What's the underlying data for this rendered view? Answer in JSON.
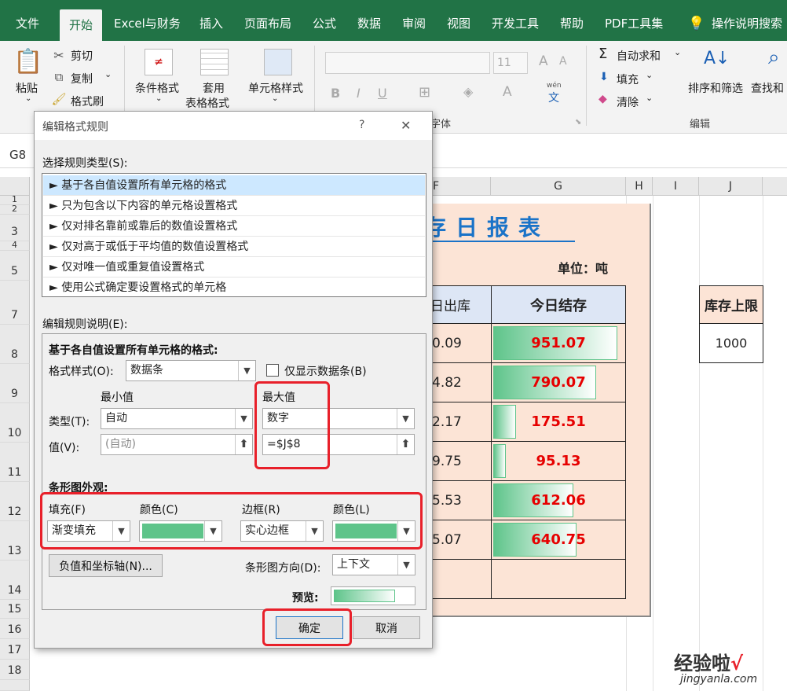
{
  "tabs": [
    "文件",
    "开始",
    "Excel与财务",
    "插入",
    "页面布局",
    "公式",
    "数据",
    "审阅",
    "视图",
    "开发工具",
    "帮助",
    "PDF工具集",
    "操作说明搜索"
  ],
  "ribbon": {
    "paste": "粘贴",
    "cut": "剪切",
    "copy": "复制",
    "format_painter": "格式刷",
    "cond_format": "条件格式",
    "table_format_1": "套用",
    "table_format_2": "表格格式",
    "cell_style": "单元格样式",
    "font_size": "11",
    "font_group": "字体",
    "bold": "B",
    "italic": "I",
    "underline": "U",
    "wen": "wén",
    "autosum": "自动求和",
    "fill": "填充",
    "clear": "清除",
    "edit_group": "编辑",
    "sort_filter": "排序和筛选",
    "find": "查找和"
  },
  "name_box": "G8",
  "columns": [
    "F",
    "G",
    "H",
    "I",
    "J"
  ],
  "rows": [
    "1",
    "2",
    "3",
    "4",
    "5",
    "7",
    "8",
    "9",
    "10",
    "11",
    "12",
    "13",
    "14",
    "15",
    "16",
    "17",
    "18"
  ],
  "report": {
    "title": "库存日报表",
    "unit": "单位：吨",
    "col_out": "日出库",
    "col_stock": "今日结存",
    "out_values": [
      "0.09",
      "4.82",
      "2.17",
      "9.75",
      "5.53",
      "5.07"
    ],
    "stock_values": [
      951.07,
      790.07,
      175.51,
      95.13,
      612.06,
      640.75
    ],
    "stock_labels": [
      "951.07",
      "790.07",
      "175.51",
      "95.13",
      "612.06",
      "640.75"
    ],
    "max_stock": 1000
  },
  "limit": {
    "header": "库存上限",
    "value": "1000"
  },
  "dialog": {
    "title": "编辑格式规则",
    "help": "?",
    "close": "✕",
    "rule_type_label": "选择规则类型(S):",
    "rules": [
      "► 基于各自值设置所有单元格的格式",
      "► 只为包含以下内容的单元格设置格式",
      "► 仅对排名靠前或靠后的数值设置格式",
      "► 仅对高于或低于平均值的数值设置格式",
      "► 仅对唯一值或重复值设置格式",
      "► 使用公式确定要设置格式的单元格"
    ],
    "desc_label": "编辑规则说明(E):",
    "desc_title": "基于各自值设置所有单元格的格式:",
    "format_style_label": "格式样式(O):",
    "format_style": "数据条",
    "show_bar_only": "仅显示数据条(B)",
    "min_label": "最小值",
    "max_label": "最大值",
    "type_label": "类型(T):",
    "min_type": "自动",
    "max_type": "数字",
    "value_label": "值(V):",
    "min_value_placeholder": "(自动)",
    "max_value": "=$J$8",
    "appearance_label": "条形图外观:",
    "fill_label": "填充(F)",
    "fill_color_label": "颜色(C)",
    "border_label": "边框(R)",
    "border_color_label": "颜色(L)",
    "fill_value": "渐变填充",
    "border_value": "实心边框",
    "bar_color": "#5ec48a",
    "neg_axis_button": "负值和坐标轴(N)...",
    "direction_label": "条形图方向(D):",
    "direction_value": "上下文",
    "preview_label": "预览:",
    "ok": "确定",
    "cancel": "取消"
  },
  "watermark": {
    "text": "经验啦",
    "check": "√",
    "url": "jingyanla.com"
  }
}
